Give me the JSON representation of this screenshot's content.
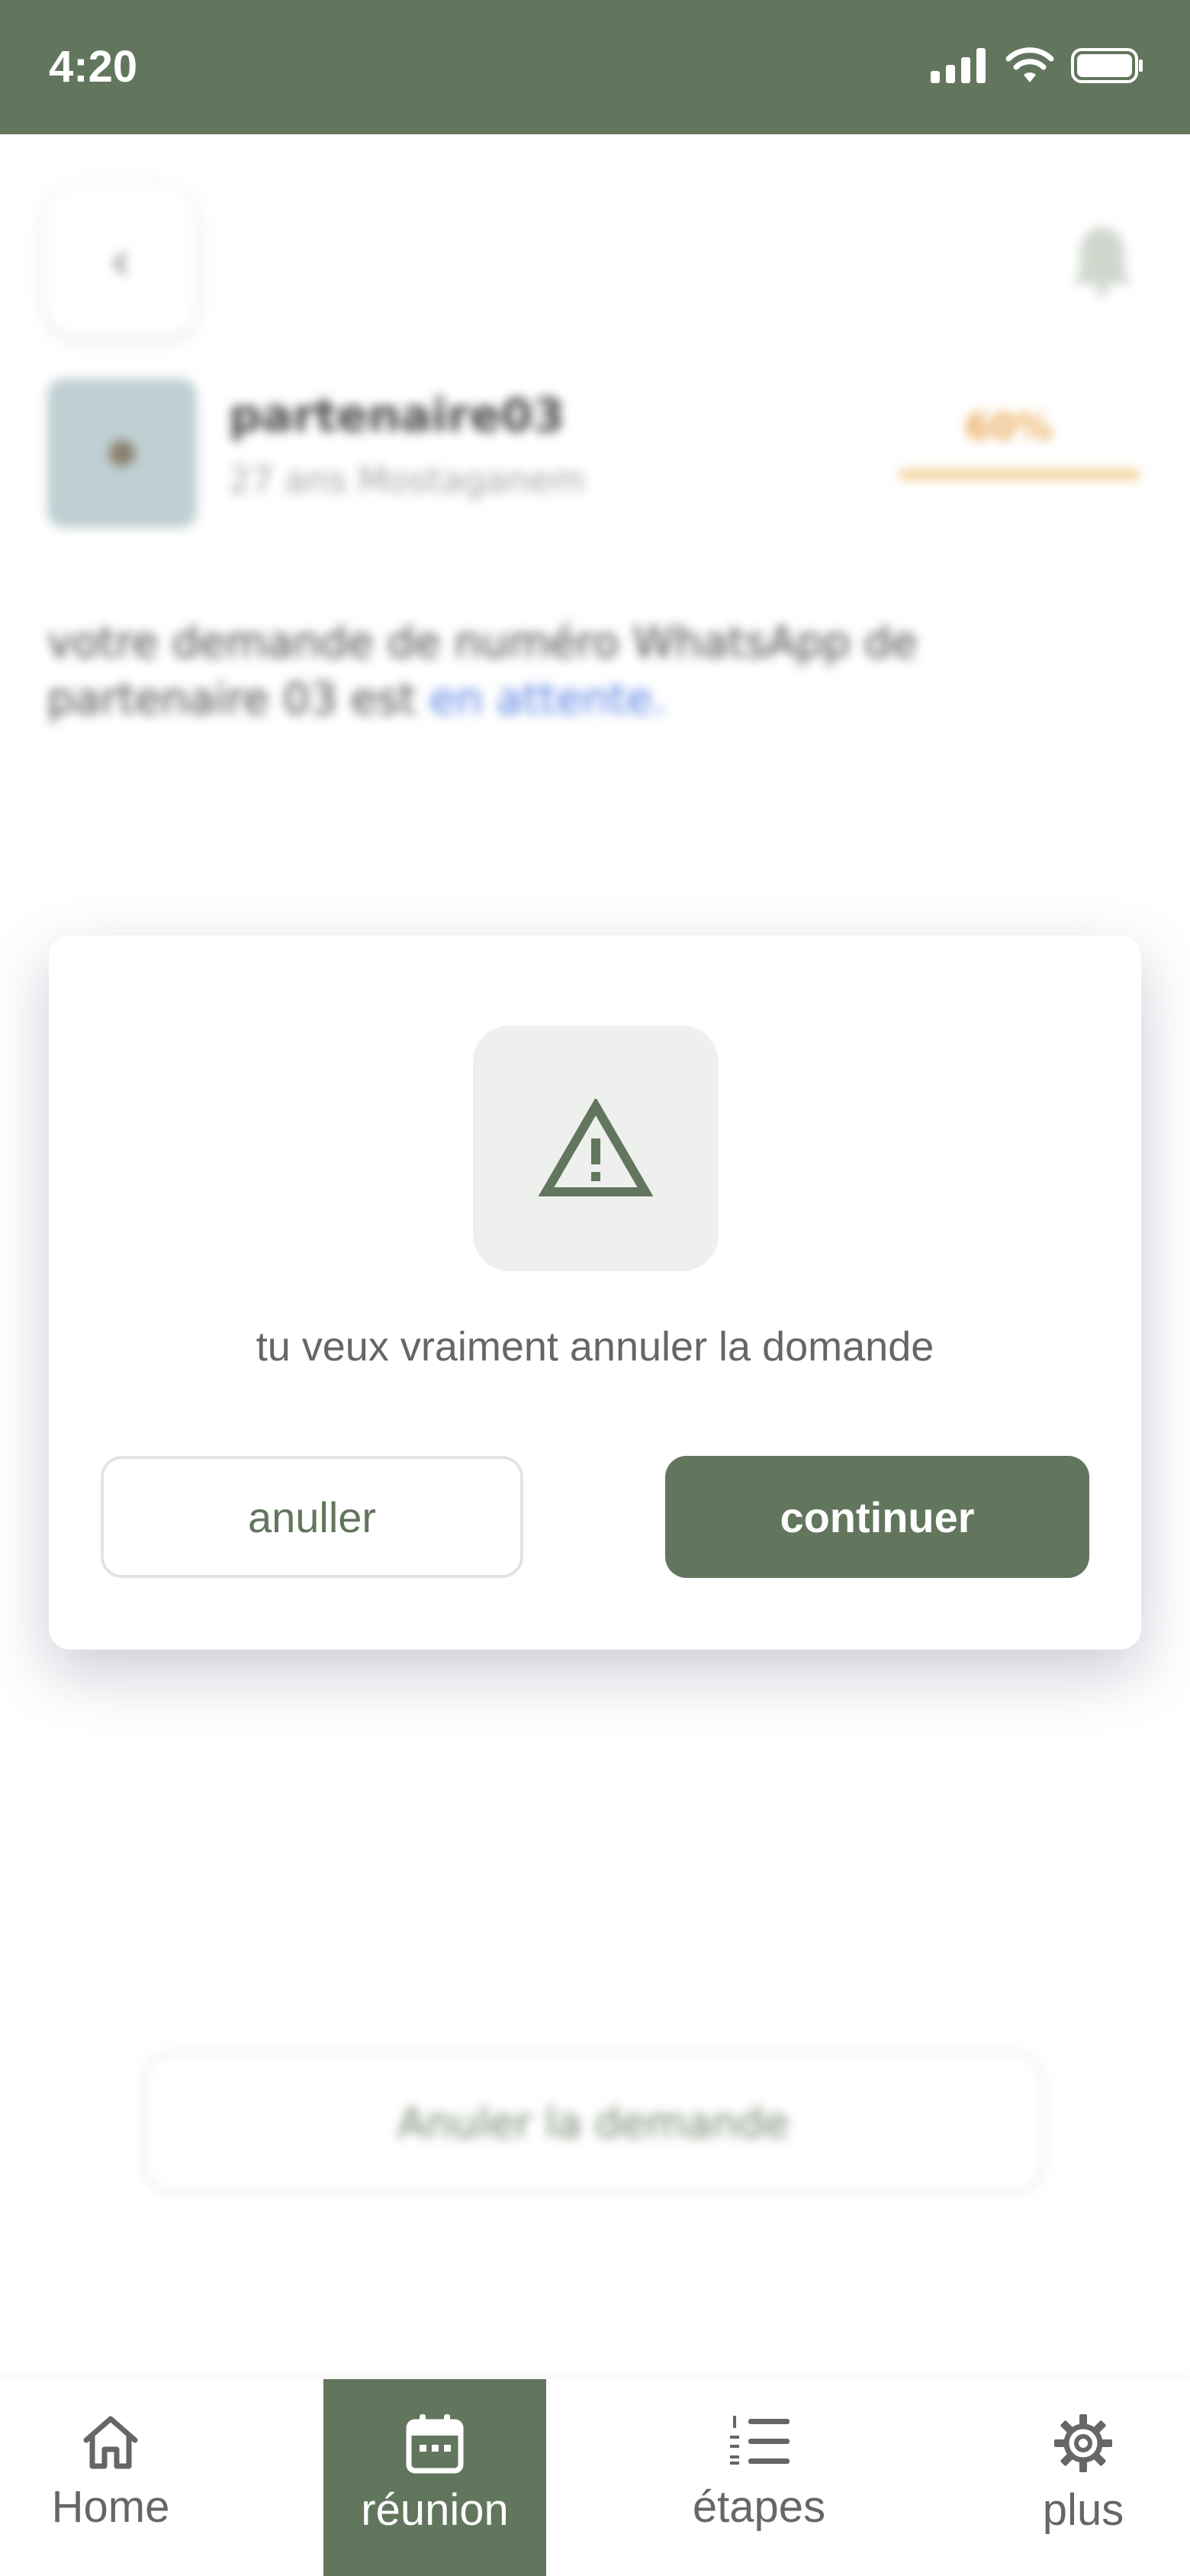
{
  "status_bar": {
    "time": "4:20"
  },
  "background": {
    "partner_name": "partenaire03",
    "partner_location": "27 ans Mostaganem",
    "match_percent": "60%",
    "message_text": "votre demande de numéro WhatsApp de partenaire 03 est ",
    "message_status_link": "en attente.",
    "cancel_request_label": "Anuler la demande"
  },
  "modal": {
    "icon": "warning-triangle-icon",
    "message": "tu veux vraiment annuler la domande",
    "cancel_label": "anuller",
    "continue_label": "continuer"
  },
  "bottom_nav": {
    "items": [
      {
        "label": "Home",
        "icon": "home-icon"
      },
      {
        "label": "réunion",
        "icon": "calendar-icon",
        "active": true
      },
      {
        "label": "étapes",
        "icon": "numbered-list-icon"
      },
      {
        "label": "plus",
        "icon": "gear-icon"
      }
    ]
  },
  "colors": {
    "brand": "#62765d",
    "accent_orange": "#e8a24a",
    "link": "#3b6ce0"
  }
}
